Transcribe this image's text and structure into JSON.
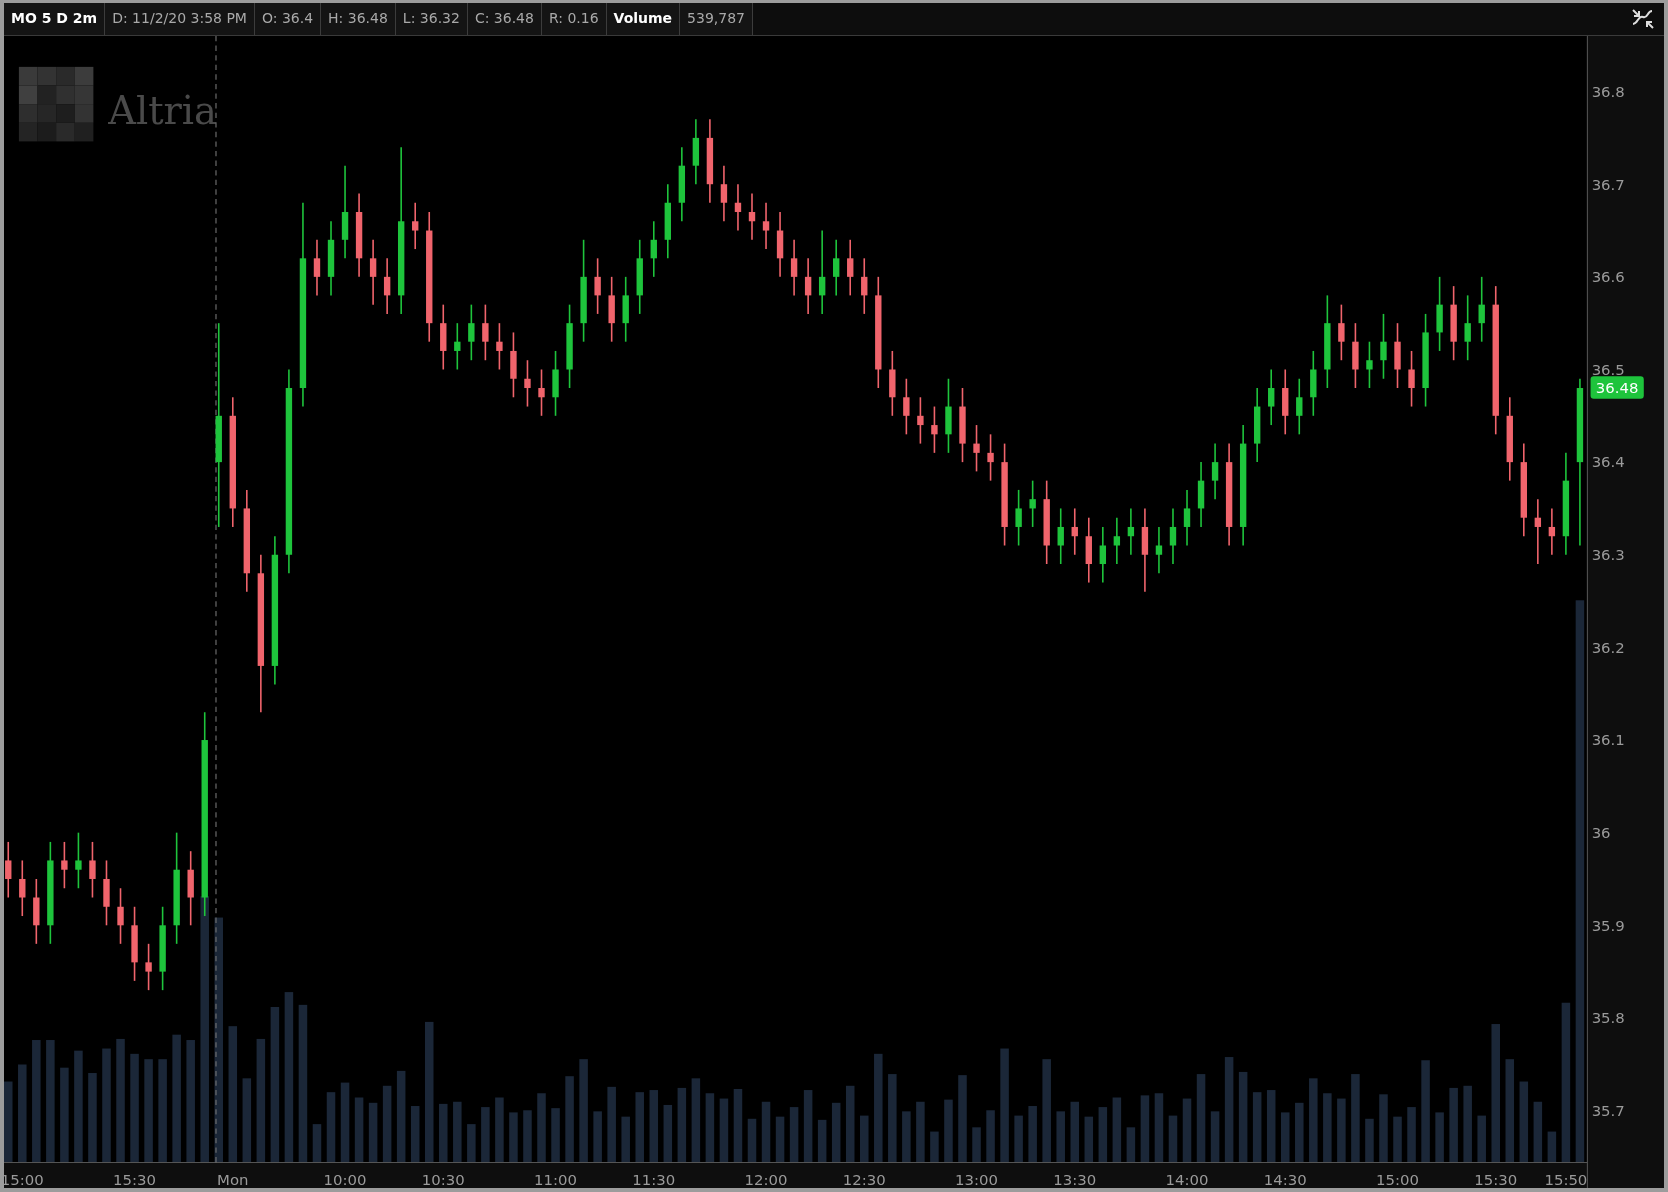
{
  "header": {
    "cells": [
      {
        "text": "MO 5 D 2m",
        "kind": "symbol"
      },
      {
        "text": "D: 11/2/20 3:58 PM",
        "kind": "value"
      },
      {
        "text": "O: 36.4",
        "kind": "value"
      },
      {
        "text": "H: 36.48",
        "kind": "value"
      },
      {
        "text": "L: 36.32",
        "kind": "value"
      },
      {
        "text": "C: 36.48",
        "kind": "value"
      },
      {
        "text": "R: 0.16",
        "kind": "value"
      },
      {
        "text": "Volume",
        "kind": "study"
      },
      {
        "text": "539,787",
        "kind": "value"
      }
    ]
  },
  "logo": {
    "text": "Altria"
  },
  "last_price": {
    "label": "36.48"
  },
  "chart": {
    "chart_data": {
      "type": "candlestick",
      "ylim": [
        35.644,
        36.86
      ],
      "yticks": [
        35.7,
        35.8,
        35.9,
        {
          "value": 36,
          "label": "36"
        },
        36.1,
        36.2,
        36.3,
        36.4,
        36.5,
        36.6,
        36.7,
        36.8
      ],
      "categories": [
        null,
        "15:00",
        null,
        null,
        null,
        null,
        null,
        null,
        null,
        "15:30",
        null,
        null,
        null,
        null,
        null,
        null,
        "Mon",
        null,
        null,
        null,
        null,
        null,
        null,
        null,
        "10:00",
        null,
        null,
        null,
        null,
        null,
        null,
        "10:30",
        null,
        null,
        null,
        null,
        null,
        null,
        null,
        "11:00",
        null,
        null,
        null,
        null,
        null,
        null,
        "11:30",
        null,
        null,
        null,
        null,
        null,
        null,
        null,
        "12:00",
        null,
        null,
        null,
        null,
        null,
        null,
        "12:30",
        null,
        null,
        null,
        null,
        null,
        null,
        null,
        "13:00",
        null,
        null,
        null,
        null,
        null,
        null,
        "13:30",
        null,
        null,
        null,
        null,
        null,
        null,
        null,
        "14:00",
        null,
        null,
        null,
        null,
        null,
        null,
        "14:30",
        null,
        null,
        null,
        null,
        null,
        null,
        null,
        "15:00",
        null,
        null,
        null,
        null,
        null,
        null,
        "15:30",
        null,
        null,
        null,
        null,
        "15:50",
        null
      ],
      "ohlc": [
        [
          35.97,
          35.99,
          35.93,
          35.95
        ],
        [
          35.95,
          35.97,
          35.91,
          35.93
        ],
        [
          35.93,
          35.95,
          35.88,
          35.9
        ],
        [
          35.9,
          35.99,
          35.88,
          35.97
        ],
        [
          35.97,
          35.99,
          35.94,
          35.96
        ],
        [
          35.96,
          36.0,
          35.94,
          35.97
        ],
        [
          35.97,
          35.99,
          35.93,
          35.95
        ],
        [
          35.95,
          35.97,
          35.9,
          35.92
        ],
        [
          35.92,
          35.94,
          35.88,
          35.9
        ],
        [
          35.9,
          35.92,
          35.84,
          35.86
        ],
        [
          35.86,
          35.88,
          35.83,
          35.85
        ],
        [
          35.85,
          35.92,
          35.83,
          35.9
        ],
        [
          35.9,
          36.0,
          35.88,
          35.96
        ],
        [
          35.96,
          35.98,
          35.9,
          35.93
        ],
        [
          35.93,
          36.13,
          35.91,
          36.1
        ],
        [
          36.4,
          36.55,
          36.33,
          36.45
        ],
        [
          36.45,
          36.47,
          36.33,
          36.35
        ],
        [
          36.35,
          36.37,
          36.26,
          36.28
        ],
        [
          36.28,
          36.3,
          36.13,
          36.18
        ],
        [
          36.18,
          36.32,
          36.16,
          36.3
        ],
        [
          36.3,
          36.5,
          36.28,
          36.48
        ],
        [
          36.48,
          36.68,
          36.46,
          36.62
        ],
        [
          36.62,
          36.64,
          36.58,
          36.6
        ],
        [
          36.6,
          36.66,
          36.58,
          36.64
        ],
        [
          36.64,
          36.72,
          36.62,
          36.67
        ],
        [
          36.67,
          36.69,
          36.6,
          36.62
        ],
        [
          36.62,
          36.64,
          36.57,
          36.6
        ],
        [
          36.6,
          36.62,
          36.56,
          36.58
        ],
        [
          36.58,
          36.74,
          36.56,
          36.66
        ],
        [
          36.66,
          36.68,
          36.63,
          36.65
        ],
        [
          36.65,
          36.67,
          36.53,
          36.55
        ],
        [
          36.55,
          36.57,
          36.5,
          36.52
        ],
        [
          36.52,
          36.55,
          36.5,
          36.53
        ],
        [
          36.53,
          36.57,
          36.51,
          36.55
        ],
        [
          36.55,
          36.57,
          36.51,
          36.53
        ],
        [
          36.53,
          36.55,
          36.5,
          36.52
        ],
        [
          36.52,
          36.54,
          36.47,
          36.49
        ],
        [
          36.49,
          36.51,
          36.46,
          36.48
        ],
        [
          36.48,
          36.5,
          36.45,
          36.47
        ],
        [
          36.47,
          36.52,
          36.45,
          36.5
        ],
        [
          36.5,
          36.57,
          36.48,
          36.55
        ],
        [
          36.55,
          36.64,
          36.53,
          36.6
        ],
        [
          36.6,
          36.62,
          36.56,
          36.58
        ],
        [
          36.58,
          36.6,
          36.53,
          36.55
        ],
        [
          36.55,
          36.6,
          36.53,
          36.58
        ],
        [
          36.58,
          36.64,
          36.56,
          36.62
        ],
        [
          36.62,
          36.66,
          36.6,
          36.64
        ],
        [
          36.64,
          36.7,
          36.62,
          36.68
        ],
        [
          36.68,
          36.74,
          36.66,
          36.72
        ],
        [
          36.72,
          36.77,
          36.7,
          36.75
        ],
        [
          36.75,
          36.77,
          36.68,
          36.7
        ],
        [
          36.7,
          36.72,
          36.66,
          36.68
        ],
        [
          36.68,
          36.7,
          36.65,
          36.67
        ],
        [
          36.67,
          36.69,
          36.64,
          36.66
        ],
        [
          36.66,
          36.68,
          36.63,
          36.65
        ],
        [
          36.65,
          36.67,
          36.6,
          36.62
        ],
        [
          36.62,
          36.64,
          36.58,
          36.6
        ],
        [
          36.6,
          36.62,
          36.56,
          36.58
        ],
        [
          36.58,
          36.65,
          36.56,
          36.6
        ],
        [
          36.6,
          36.64,
          36.58,
          36.62
        ],
        [
          36.62,
          36.64,
          36.58,
          36.6
        ],
        [
          36.6,
          36.62,
          36.56,
          36.58
        ],
        [
          36.58,
          36.6,
          36.48,
          36.5
        ],
        [
          36.5,
          36.52,
          36.45,
          36.47
        ],
        [
          36.47,
          36.49,
          36.43,
          36.45
        ],
        [
          36.45,
          36.47,
          36.42,
          36.44
        ],
        [
          36.44,
          36.46,
          36.41,
          36.43
        ],
        [
          36.43,
          36.49,
          36.41,
          36.46
        ],
        [
          36.46,
          36.48,
          36.4,
          36.42
        ],
        [
          36.42,
          36.44,
          36.39,
          36.41
        ],
        [
          36.41,
          36.43,
          36.38,
          36.4
        ],
        [
          36.4,
          36.42,
          36.31,
          36.33
        ],
        [
          36.33,
          36.37,
          36.31,
          36.35
        ],
        [
          36.35,
          36.38,
          36.33,
          36.36
        ],
        [
          36.36,
          36.38,
          36.29,
          36.31
        ],
        [
          36.31,
          36.35,
          36.29,
          36.33
        ],
        [
          36.33,
          36.35,
          36.3,
          36.32
        ],
        [
          36.32,
          36.34,
          36.27,
          36.29
        ],
        [
          36.29,
          36.33,
          36.27,
          36.31
        ],
        [
          36.31,
          36.34,
          36.29,
          36.32
        ],
        [
          36.32,
          36.35,
          36.3,
          36.33
        ],
        [
          36.33,
          36.35,
          36.26,
          36.3
        ],
        [
          36.3,
          36.33,
          36.28,
          36.31
        ],
        [
          36.31,
          36.35,
          36.29,
          36.33
        ],
        [
          36.33,
          36.37,
          36.31,
          36.35
        ],
        [
          36.35,
          36.4,
          36.33,
          36.38
        ],
        [
          36.38,
          36.42,
          36.36,
          36.4
        ],
        [
          36.4,
          36.42,
          36.31,
          36.33
        ],
        [
          36.33,
          36.44,
          36.31,
          36.42
        ],
        [
          36.42,
          36.48,
          36.4,
          36.46
        ],
        [
          36.46,
          36.5,
          36.44,
          36.48
        ],
        [
          36.48,
          36.5,
          36.43,
          36.45
        ],
        [
          36.45,
          36.49,
          36.43,
          36.47
        ],
        [
          36.47,
          36.52,
          36.45,
          36.5
        ],
        [
          36.5,
          36.58,
          36.48,
          36.55
        ],
        [
          36.55,
          36.57,
          36.51,
          36.53
        ],
        [
          36.53,
          36.55,
          36.48,
          36.5
        ],
        [
          36.5,
          36.53,
          36.48,
          36.51
        ],
        [
          36.51,
          36.56,
          36.49,
          36.53
        ],
        [
          36.53,
          36.55,
          36.48,
          36.5
        ],
        [
          36.5,
          36.52,
          36.46,
          36.48
        ],
        [
          36.48,
          36.56,
          36.46,
          36.54
        ],
        [
          36.54,
          36.6,
          36.52,
          36.57
        ],
        [
          36.57,
          36.59,
          36.51,
          36.53
        ],
        [
          36.53,
          36.58,
          36.51,
          36.55
        ],
        [
          36.55,
          36.6,
          36.53,
          36.57
        ],
        [
          36.57,
          36.59,
          36.43,
          36.45
        ],
        [
          36.45,
          36.47,
          36.38,
          36.4
        ],
        [
          36.4,
          36.42,
          36.32,
          36.34
        ],
        [
          36.34,
          36.36,
          36.29,
          36.33
        ],
        [
          36.33,
          36.35,
          36.3,
          36.32
        ],
        [
          36.32,
          36.41,
          36.3,
          36.38
        ],
        [
          36.4,
          36.49,
          36.31,
          36.48
        ]
      ]
    }
  }
}
